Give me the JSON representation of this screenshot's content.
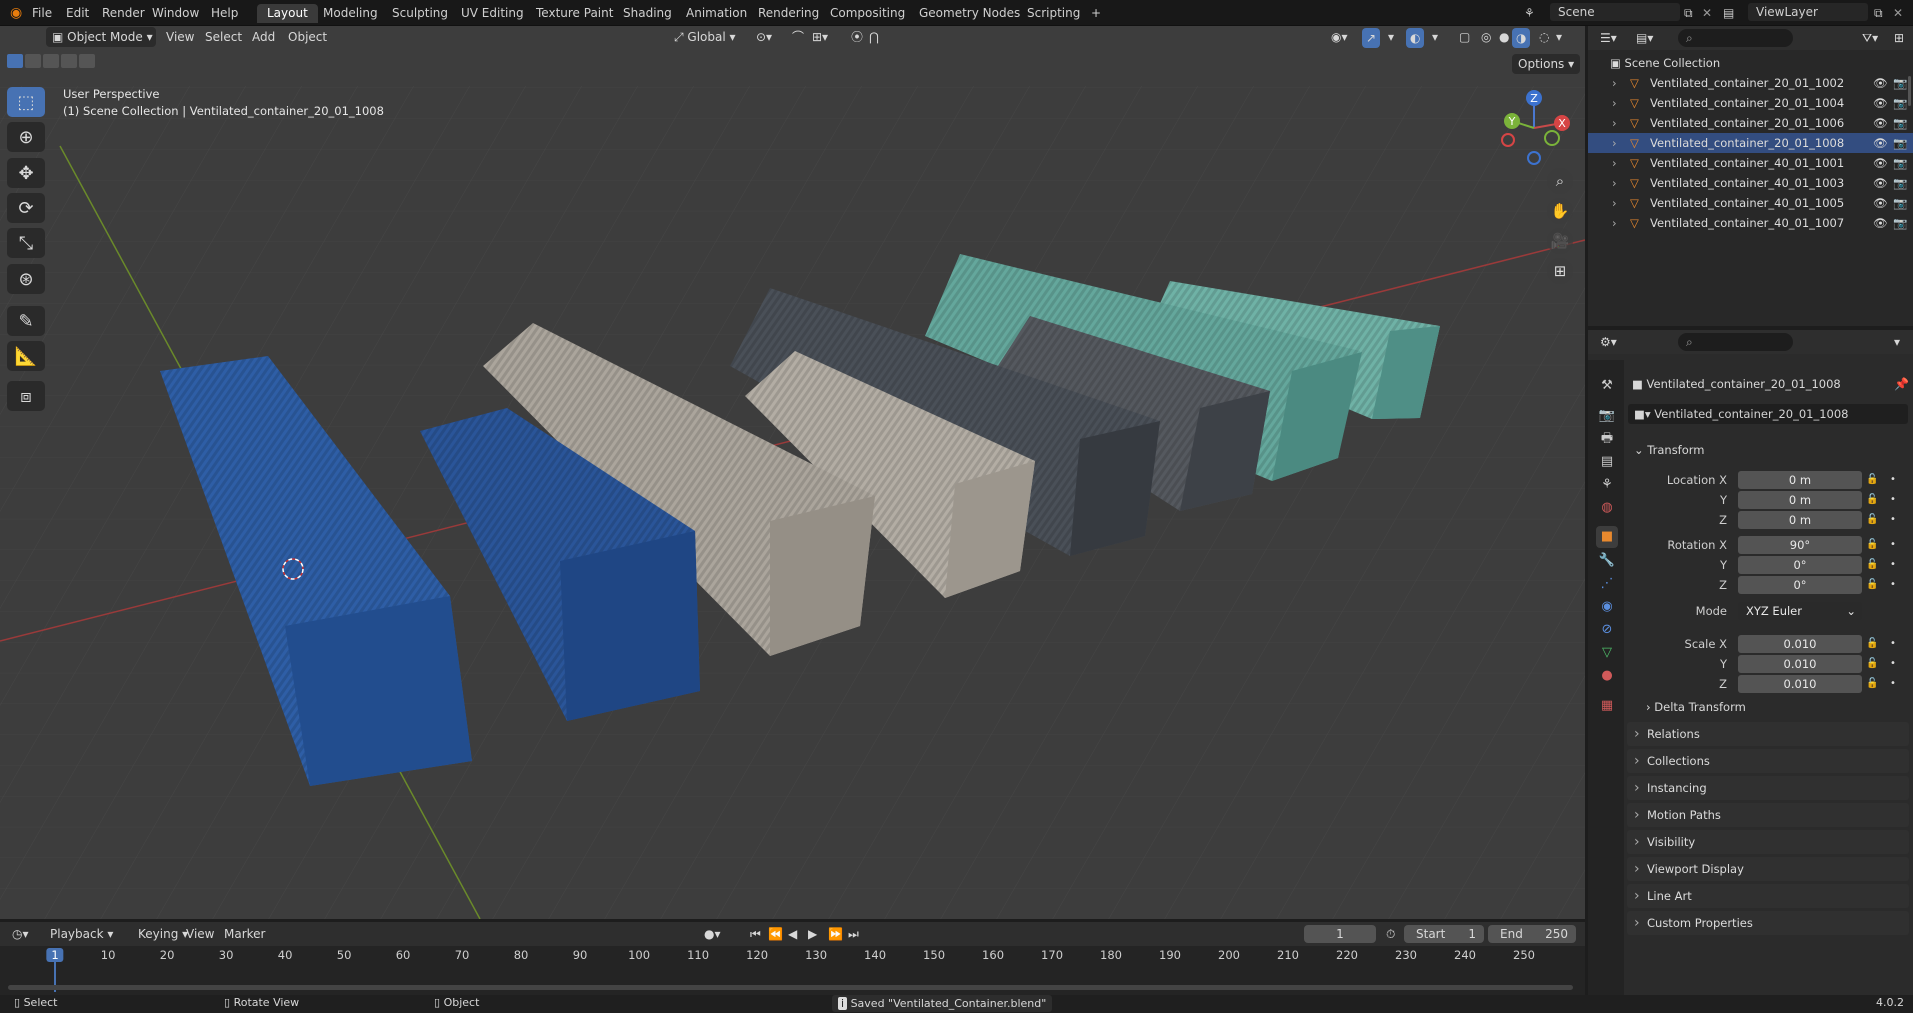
{
  "topbar": {
    "menus": [
      "File",
      "Edit",
      "Render",
      "Window",
      "Help"
    ],
    "workspaces": [
      "Layout",
      "Modeling",
      "Sculpting",
      "UV Editing",
      "Texture Paint",
      "Shading",
      "Animation",
      "Rendering",
      "Compositing",
      "Geometry Nodes",
      "Scripting"
    ],
    "active_workspace": "Layout",
    "add_tab": "+",
    "scene": "Scene",
    "view_layer": "ViewLayer"
  },
  "viewport": {
    "mode": "Object Mode",
    "menus": [
      "View",
      "Select",
      "Add",
      "Object"
    ],
    "orientation": "Global",
    "options": "Options",
    "overlay_title": "User Perspective",
    "overlay_subtitle": "(1) Scene Collection | Ventilated_container_20_01_1008",
    "gizmo": {
      "x": "X",
      "y": "Y",
      "z": "Z"
    }
  },
  "outliner": {
    "root": "Scene Collection",
    "items": [
      "Ventilated_container_20_01_1002",
      "Ventilated_container_20_01_1004",
      "Ventilated_container_20_01_1006",
      "Ventilated_container_20_01_1008",
      "Ventilated_container_40_01_1001",
      "Ventilated_container_40_01_1003",
      "Ventilated_container_40_01_1005",
      "Ventilated_container_40_01_1007"
    ],
    "selected_index": 3
  },
  "properties": {
    "object_name": "Ventilated_container_20_01_1008",
    "datablock": "Ventilated_container_20_01_1008",
    "transform_title": "Transform",
    "location": {
      "label": "Location X",
      "x": "0 m",
      "y": "0 m",
      "z": "0 m"
    },
    "rotation": {
      "label": "Rotation X",
      "x": "90°",
      "y": "0°",
      "z": "0°"
    },
    "mode_label": "Mode",
    "mode_value": "XYZ Euler",
    "scale": {
      "label": "Scale X",
      "x": "0.010",
      "y": "0.010",
      "z": "0.010"
    },
    "axis_y": "Y",
    "axis_z": "Z",
    "delta": "Delta Transform",
    "panels": [
      "Relations",
      "Collections",
      "Instancing",
      "Motion Paths",
      "Visibility",
      "Viewport Display",
      "Line Art",
      "Custom Properties"
    ]
  },
  "timeline": {
    "menus": [
      "Playback",
      "Keying",
      "View",
      "Marker"
    ],
    "current_frame": "1",
    "start_label": "Start",
    "start": "1",
    "end_label": "End",
    "end": "250",
    "ticks": [
      "1",
      "10",
      "20",
      "30",
      "40",
      "50",
      "60",
      "70",
      "80",
      "90",
      "100",
      "110",
      "120",
      "130",
      "140",
      "150",
      "160",
      "170",
      "180",
      "190",
      "200",
      "210",
      "220",
      "230",
      "240",
      "250"
    ]
  },
  "status": {
    "select": "Select",
    "rotate": "Rotate View",
    "object": "Object",
    "message": "Saved \"Ventilated_Container.blend\"",
    "version": "4.0.2"
  },
  "colors": {
    "accent": "#4772b3",
    "container_blue": "#2a5599",
    "container_white": "#a9a39a",
    "container_gray": "#4a5058",
    "container_teal": "#5fa59a",
    "object_orange": "#e8892e"
  }
}
